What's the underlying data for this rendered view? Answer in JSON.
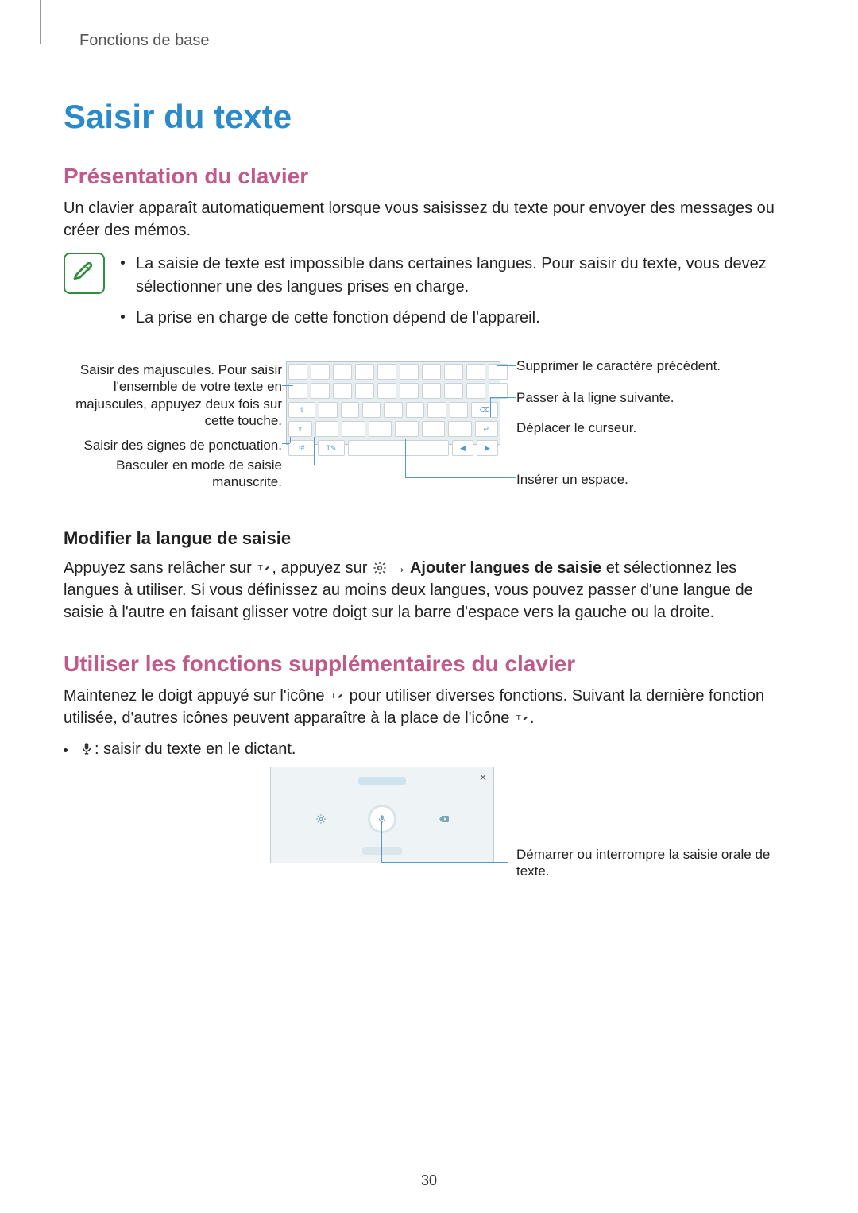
{
  "breadcrumb": "Fonctions de base",
  "title": "Saisir du texte",
  "section1": {
    "heading": "Présentation du clavier",
    "intro": "Un clavier apparaît automatiquement lorsque vous saisissez du texte pour envoyer des messages ou créer des mémos.",
    "notes": [
      "La saisie de texte est impossible dans certaines langues. Pour saisir du texte, vous devez sélectionner une des langues prises en charge.",
      "La prise en charge de cette fonction dépend de l'appareil."
    ],
    "callouts_left": [
      "Saisir des majuscules. Pour saisir l'ensemble de votre texte en majuscules, appuyez deux fois sur cette touche.",
      "Saisir des signes de ponctuation.",
      "Basculer en mode de saisie manuscrite."
    ],
    "callouts_right": [
      "Supprimer le caractère précédent.",
      "Passer à la ligne suivante.",
      "Déplacer le curseur.",
      "Insérer un espace."
    ],
    "subhead": "Modifier la langue de saisie",
    "lang_p1a": "Appuyez sans relâcher sur ",
    "lang_p1b": ", appuyez sur ",
    "lang_p1c": " → ",
    "lang_bold": "Ajouter langues de saisie",
    "lang_p1d": " et sélectionnez les langues à utiliser. Si vous définissez au moins deux langues, vous pouvez passer d'une langue de saisie à l'autre en faisant glisser votre doigt sur la barre d'espace vers la gauche ou la droite."
  },
  "section2": {
    "heading": "Utiliser les fonctions supplémentaires du clavier",
    "p1a": "Maintenez le doigt appuyé sur l'icône ",
    "p1b": " pour utiliser diverses fonctions. Suivant la dernière fonction utilisée, d'autres icônes peuvent apparaître à la place de l'icône ",
    "p1c": ".",
    "bullet": " : saisir du texte en le dictant.",
    "voice_callout": "Démarrer ou interrompre la saisie orale de texte."
  },
  "page_number": "30"
}
